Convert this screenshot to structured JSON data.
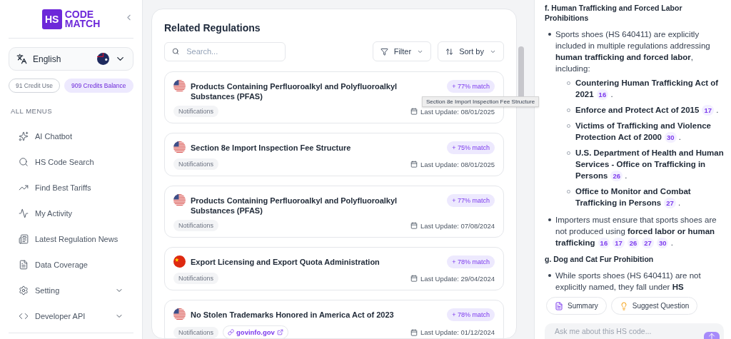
{
  "sidebar": {
    "logo": {
      "mark": "HS",
      "line_1": "CODE",
      "line_2": "MATCH"
    },
    "language": {
      "label": "English"
    },
    "credits": [
      {
        "text": "91 Credit Use",
        "kind": "outline"
      },
      {
        "text": "909 Credits Balance",
        "kind": "filled"
      }
    ],
    "menu_heading": "ALL MENUS",
    "items": [
      {
        "label": "AI Chatbot",
        "expandable": false
      },
      {
        "label": "HS Code Search",
        "expandable": false
      },
      {
        "label": "Find Best Tariffs",
        "expandable": false
      },
      {
        "label": "My Activity",
        "expandable": false
      },
      {
        "label": "Latest Regulation News",
        "expandable": false
      },
      {
        "label": "Data Coverage",
        "expandable": false
      },
      {
        "label": "Setting",
        "expandable": true
      },
      {
        "label": "Developer API",
        "expandable": true
      }
    ]
  },
  "regulations": {
    "title": "Related Regulations",
    "search": {
      "placeholder": "Search..."
    },
    "filter": "Filter",
    "sort": "Sort by",
    "items": [
      {
        "kind": "us",
        "title": "Products Containing Perfluoroalkyl and Polyfluoroalkyl Substances (PFAS)",
        "match": "+ 77% match",
        "tag": "Notifications",
        "date": "Last Update: 08/01/2025"
      },
      {
        "kind": "us",
        "title": "Section 8e Import Inspection Fee Structure",
        "match": "+ 75% match",
        "tag": "Notifications",
        "date": "Last Update: 08/01/2025"
      },
      {
        "kind": "us",
        "title": "Products Containing Perfluoroalkyl and Polyfluoroalkyl Substances (PFAS)",
        "match": "+ 77% match",
        "tag": "Notifications",
        "date": "Last Update: 07/08/2024"
      },
      {
        "kind": "cn",
        "title": "Export Licensing and Export Quota Administration",
        "match": "+ 78% match",
        "tag": "Notifications",
        "date": "Last Update: 29/04/2024"
      },
      {
        "kind": "us",
        "title": "No Stolen Trademarks Honored in America Act of 2023",
        "match": "+ 78% match",
        "tag": "Notifications",
        "link": "govinfo.gov",
        "date": "Last Update: 01/12/2024"
      }
    ],
    "tooltip": "Section 8e Import Inspection Fee Structure"
  },
  "chat": {
    "blocks": [
      {
        "kind": "heading",
        "text": "f. Human Trafficking and Forced Labor Prohibitions"
      },
      {
        "kind": "bullet",
        "text": "Sports shoes (HS 640411) are explicitly included in multiple regulations addressing **human trafficking and forced labor**, including:",
        "children": [
          {
            "text": "Countering Human Trafficking Act of 2021",
            "citations": [
              "16"
            ],
            "suffix": "."
          },
          {
            "text": "Enforce and Protect Act of 2015",
            "citations": [
              "17"
            ],
            "suffix": "."
          },
          {
            "text": "Victims of Trafficking and Violence Protection Act of 2000",
            "citations": [
              "30"
            ],
            "suffix": "."
          },
          {
            "text": "U.S. Department of Health and Human Services - Office on Trafficking in Persons",
            "citations": [
              "26"
            ],
            "suffix": "."
          },
          {
            "text": "Office to Monitor and Combat Trafficking in Persons",
            "citations": [
              "27"
            ],
            "suffix": "."
          }
        ]
      },
      {
        "kind": "bullet",
        "text": "Importers must ensure that sports shoes are not produced using **forced labor or human trafficking**",
        "citations": [
          "16",
          "17",
          "26",
          "27",
          "30"
        ],
        "suffix": "."
      },
      {
        "kind": "heading",
        "text": "g. Dog and Cat Fur Prohibition"
      },
      {
        "kind": "bullet",
        "text": "While sports shoes (HS 640411) are not explicitly named, they fall under **HS**"
      }
    ],
    "actions": [
      "Summary",
      "Suggest Question"
    ],
    "input": {
      "placeholder": "Ask me about this HS code..."
    }
  }
}
